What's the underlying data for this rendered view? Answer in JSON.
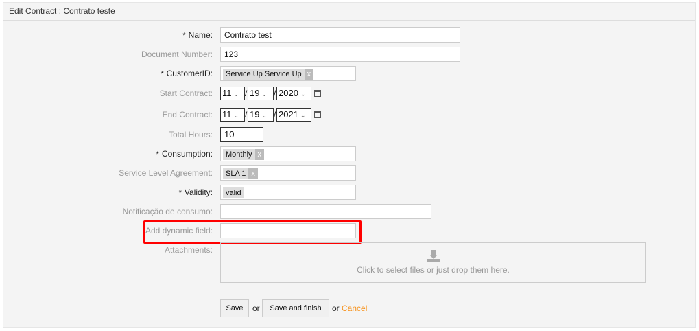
{
  "header": {
    "title": "Edit Contract : Contrato teste"
  },
  "fields": {
    "name": {
      "label": "Name:",
      "value": "Contrato test"
    },
    "document_number": {
      "label": "Document Number:",
      "value": "123"
    },
    "customer_id": {
      "label": "CustomerID:",
      "tag": "Service Up Service Up"
    },
    "start_contract": {
      "label": "Start Contract:",
      "month": "11",
      "day": "19",
      "year": "2020"
    },
    "end_contract": {
      "label": "End Contract:",
      "month": "11",
      "day": "19",
      "year": "2021"
    },
    "total_hours": {
      "label": "Total Hours:",
      "value": "10"
    },
    "consumption": {
      "label": "Consumption:",
      "tag": "Monthly"
    },
    "sla": {
      "label": "Service Level Agreement:",
      "tag": "SLA 1"
    },
    "validity": {
      "label": "Validity:",
      "tag": "valid"
    },
    "notificacao": {
      "label": "Notificação de consumo:",
      "value": ""
    },
    "dynamic_field": {
      "label": "Add dynamic field:",
      "value": ""
    },
    "attachments": {
      "label": "Attachments:",
      "drop_text": "Click to select files or just drop them here."
    }
  },
  "required_marker": "*",
  "remove_marker": "x",
  "date_separator": "/",
  "actions": {
    "save": "Save",
    "or1": "or",
    "save_finish": "Save and finish",
    "or2": "or",
    "cancel": "Cancel"
  },
  "colors": {
    "highlight": "#ff0000",
    "cancel": "#f7931e"
  }
}
